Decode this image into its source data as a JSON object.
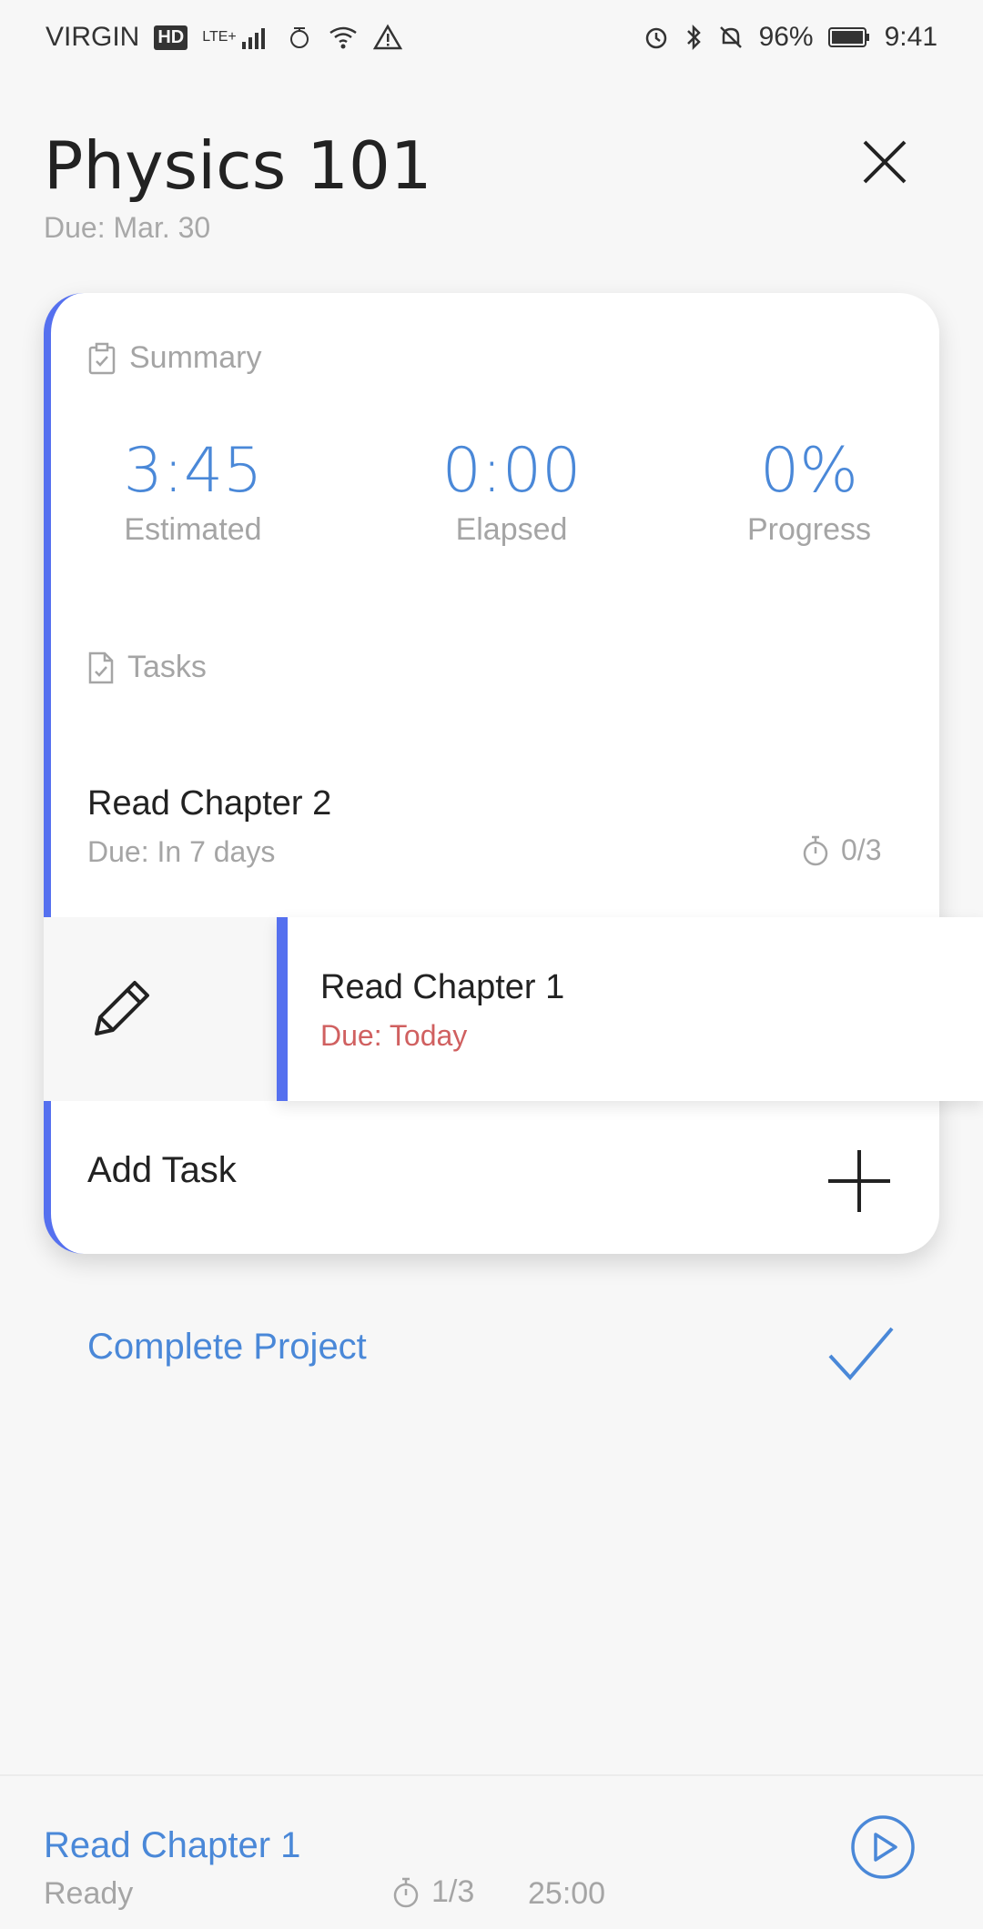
{
  "status_bar": {
    "carrier": "VIRGIN",
    "hd": "HD",
    "network": "LTE+",
    "battery": "96%",
    "time": "9:41",
    "icons": [
      "signal-icon",
      "data-saver-icon",
      "wifi-icon",
      "warning-icon",
      "alarm-icon",
      "bluetooth-icon",
      "mute-icon",
      "battery-icon"
    ]
  },
  "header": {
    "title": "Physics 101",
    "due": "Due: Mar. 30"
  },
  "summary": {
    "label": "Summary",
    "stats": [
      {
        "value": "3:45",
        "label": "Estimated"
      },
      {
        "value": "0:00",
        "label": "Elapsed"
      },
      {
        "value": "0%",
        "label": "Progress"
      }
    ]
  },
  "tasks": {
    "label": "Tasks",
    "items": [
      {
        "title": "Read Chapter 2",
        "due": "Due: In 7 days",
        "count": "0/3"
      },
      {
        "title": "Read Chapter 1",
        "due": "Due: Today"
      }
    ],
    "add_label": "Add Task"
  },
  "complete_label": "Complete Project",
  "bottom_bar": {
    "title": "Read Chapter 1",
    "status": "Ready",
    "count": "1/3",
    "time": "25:00"
  },
  "colors": {
    "accent": "#4a88d8",
    "stripe": "#5570ef",
    "due_today": "#d06060",
    "muted": "#a5a5a5"
  }
}
